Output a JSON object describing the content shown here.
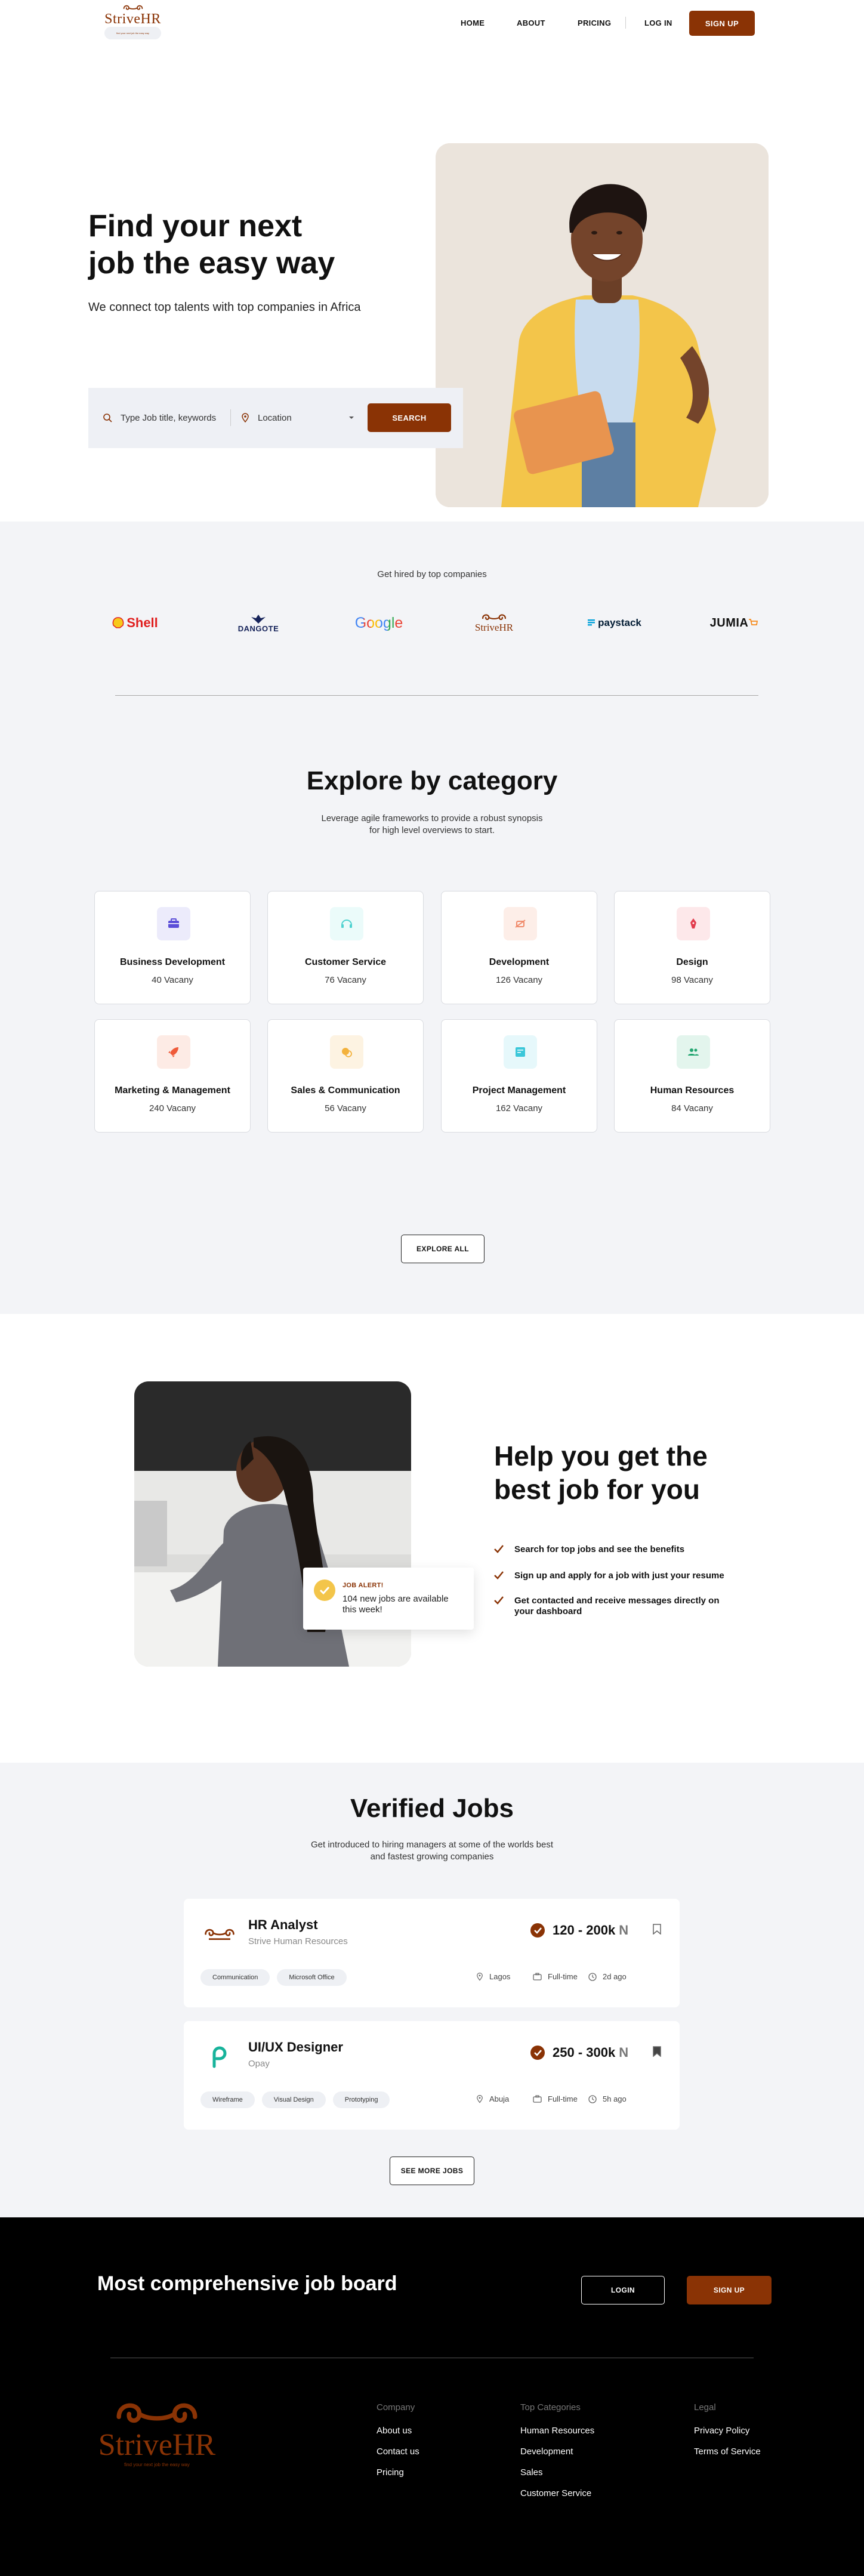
{
  "brand": {
    "name": "StriveHR",
    "tagline": "find your next job the easy way",
    "color": "#8a3305"
  },
  "nav": {
    "home": "HOME",
    "about": "ABOUT",
    "pricing": "PRICING",
    "login": "LOG IN",
    "signup": "SIGN UP"
  },
  "hero": {
    "title_line1": "Find your next",
    "title_line2": "job the easy way",
    "subtitle": "We connect top talents with top companies in Africa",
    "search": {
      "keyword_placeholder": "Type Job title, keywords",
      "location_placeholder": "Location",
      "button": "SEARCH"
    }
  },
  "companies": {
    "label": "Get hired by top companies",
    "logos": [
      "Shell",
      "DANGOTE",
      "Google",
      "StriveHR",
      "paystack",
      "JUMIA"
    ]
  },
  "category": {
    "title": "Explore by category",
    "subtitle_line1": "Leverage agile frameworks to provide a robust synopsis",
    "subtitle_line2": "for high level overviews to start.",
    "items": [
      {
        "name": "Business Development",
        "count": "40 Vacany",
        "icon": "briefcase-icon",
        "color": "#5b4ed8",
        "bg": "#ecebfb"
      },
      {
        "name": "Customer Service",
        "count": "76 Vacany",
        "icon": "headset-icon",
        "color": "#4fd2d0",
        "bg": "#ebfbfa"
      },
      {
        "name": "Development",
        "count": "126 Vacany",
        "icon": "code-icon",
        "color": "#f08a6a",
        "bg": "#fdeee8"
      },
      {
        "name": "Design",
        "count": "98 Vacany",
        "icon": "pen-icon",
        "color": "#e23d4e",
        "bg": "#fde8ea"
      },
      {
        "name": "Marketing & Management",
        "count": "240 Vacany",
        "icon": "rocket-icon",
        "color": "#ef5b3a",
        "bg": "#fdebe5"
      },
      {
        "name": "Sales & Communication",
        "count": "56 Vacany",
        "icon": "chat-icon",
        "color": "#f3b23d",
        "bg": "#fdf3e2"
      },
      {
        "name": "Project Management",
        "count": "162 Vacany",
        "icon": "board-icon",
        "color": "#3bc7d9",
        "bg": "#e6f8fb"
      },
      {
        "name": "Human Resources",
        "count": "84 Vacany",
        "icon": "people-icon",
        "color": "#21a56f",
        "bg": "#e3f5ed"
      }
    ],
    "explore_button": "EXPLORE ALL"
  },
  "help": {
    "title_line1": "Help you get the",
    "title_line2": "best job for you",
    "alert_label": "JOB ALERT!",
    "alert_text_line1": "104 new jobs are available",
    "alert_text_line2": "this week!",
    "points": [
      "Search for top jobs and see the benefits",
      "Sign up and apply for a job with just your resume",
      "Get contacted and receive messages directly on"
    ],
    "point3_line2": "your dashboard"
  },
  "jobs": {
    "title": "Verified Jobs",
    "subtitle_line1": "Get introduced to hiring managers at some of the worlds best",
    "subtitle_line2": "and fastest growing companies",
    "list": [
      {
        "title": "HR Analyst",
        "company": "Strive Human Resources",
        "salary": "120 - 200k",
        "currency": "N",
        "tags": [
          "Communication",
          "Microsoft Office"
        ],
        "location": "Lagos",
        "type": "Full-time",
        "posted": "2d ago",
        "saved": false
      },
      {
        "title": "UI/UX Designer",
        "company": "Opay",
        "salary": "250 - 300k",
        "currency": "N",
        "tags": [
          "Wireframe",
          "Visual Design",
          "Prototyping"
        ],
        "location": "Abuja",
        "type": "Full-time",
        "posted": "5h ago",
        "saved": true
      }
    ],
    "more_button": "SEE MORE JOBS"
  },
  "footer": {
    "cta": "Most comprehensive job board",
    "login": "LOGIN",
    "signup": "SIGN UP",
    "company_head": "Company",
    "company_links": [
      "About us",
      "Contact us",
      "Pricing"
    ],
    "categories_head": "Top Categories",
    "categories_links": [
      "Human Resources",
      "Development",
      "Sales",
      "Customer Service"
    ],
    "legal_head": "Legal",
    "legal_links": [
      "Privacy Policy",
      "Terms of Service"
    ]
  }
}
